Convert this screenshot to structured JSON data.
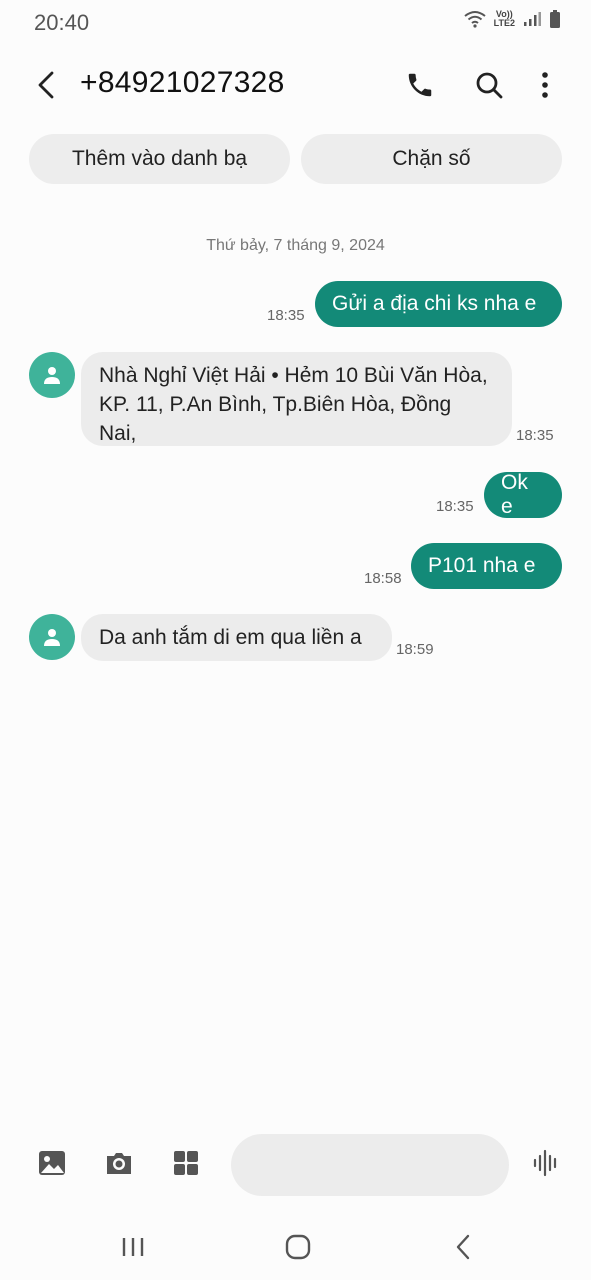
{
  "status_bar": {
    "time": "20:40",
    "network_top": "Vo))",
    "network_bottom": "LTE2"
  },
  "header": {
    "title": "+84921027328"
  },
  "actions": {
    "add_contact": "Thêm vào danh bạ",
    "block_number": "Chặn số"
  },
  "conversation": {
    "date": "Thứ bảy, 7 tháng 9, 2024",
    "messages": [
      {
        "direction": "outgoing",
        "text": "Gửi a địa chi ks nha e",
        "time": "18:35"
      },
      {
        "direction": "incoming",
        "text": "Nhà Nghỉ Việt Hải • Hẻm 10 Bùi Văn Hòa, KP. 11, P.An Bình, Tp.Biên Hòa, Đồng Nai,",
        "time": "18:35"
      },
      {
        "direction": "outgoing",
        "text": "Ok e",
        "time": "18:35"
      },
      {
        "direction": "outgoing",
        "text": "P101 nha e",
        "time": "18:58"
      },
      {
        "direction": "incoming",
        "text": "Da anh tắm di em qua liền a",
        "time": "18:59"
      }
    ]
  },
  "composer": {
    "placeholder": ""
  },
  "colors": {
    "outgoing_bubble": "#138a78",
    "incoming_bubble": "#ececec",
    "avatar": "#3fb39a"
  }
}
